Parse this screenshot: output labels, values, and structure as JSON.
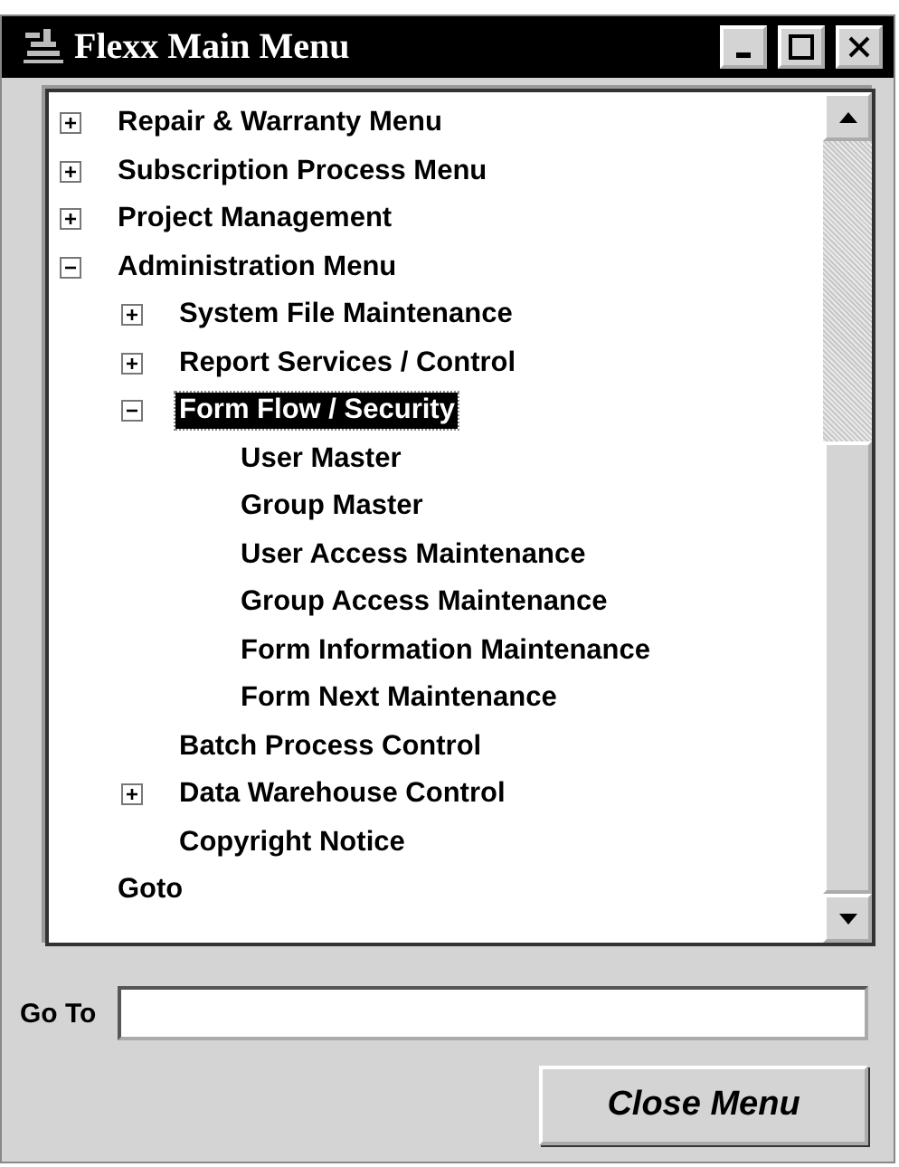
{
  "window": {
    "title": "Flexx Main Menu"
  },
  "tree": [
    {
      "label": "Repair & Warranty Menu",
      "kind": "branch",
      "expanded": false,
      "selected": false
    },
    {
      "label": "Subscription Process Menu",
      "kind": "branch",
      "expanded": false,
      "selected": false
    },
    {
      "label": "Project Management",
      "kind": "branch",
      "expanded": false,
      "selected": false
    },
    {
      "label": "Administration Menu",
      "kind": "branch",
      "expanded": true,
      "selected": false,
      "children": [
        {
          "label": "System File Maintenance",
          "kind": "branch",
          "expanded": false,
          "selected": false
        },
        {
          "label": "Report Services / Control",
          "kind": "branch",
          "expanded": false,
          "selected": false
        },
        {
          "label": "Form Flow / Security",
          "kind": "branch",
          "expanded": true,
          "selected": true,
          "children": [
            {
              "label": "User Master",
              "kind": "leaf",
              "selected": false
            },
            {
              "label": "Group Master",
              "kind": "leaf",
              "selected": false
            },
            {
              "label": "User Access Maintenance",
              "kind": "leaf",
              "selected": false
            },
            {
              "label": "Group Access Maintenance",
              "kind": "leaf",
              "selected": false
            },
            {
              "label": "Form Information Maintenance",
              "kind": "leaf",
              "selected": false
            },
            {
              "label": "Form Next Maintenance",
              "kind": "leaf",
              "selected": false
            }
          ]
        },
        {
          "label": "Batch Process Control",
          "kind": "leaf",
          "selected": false
        },
        {
          "label": "Data Warehouse Control",
          "kind": "branch",
          "expanded": false,
          "selected": false
        },
        {
          "label": "Copyright Notice",
          "kind": "leaf",
          "selected": false
        }
      ]
    },
    {
      "label": "Goto",
      "kind": "leaf",
      "selected": false
    }
  ],
  "goto_field": {
    "label": "Go To"
  },
  "buttons": [
    {
      "label": "Close Menu"
    }
  ]
}
